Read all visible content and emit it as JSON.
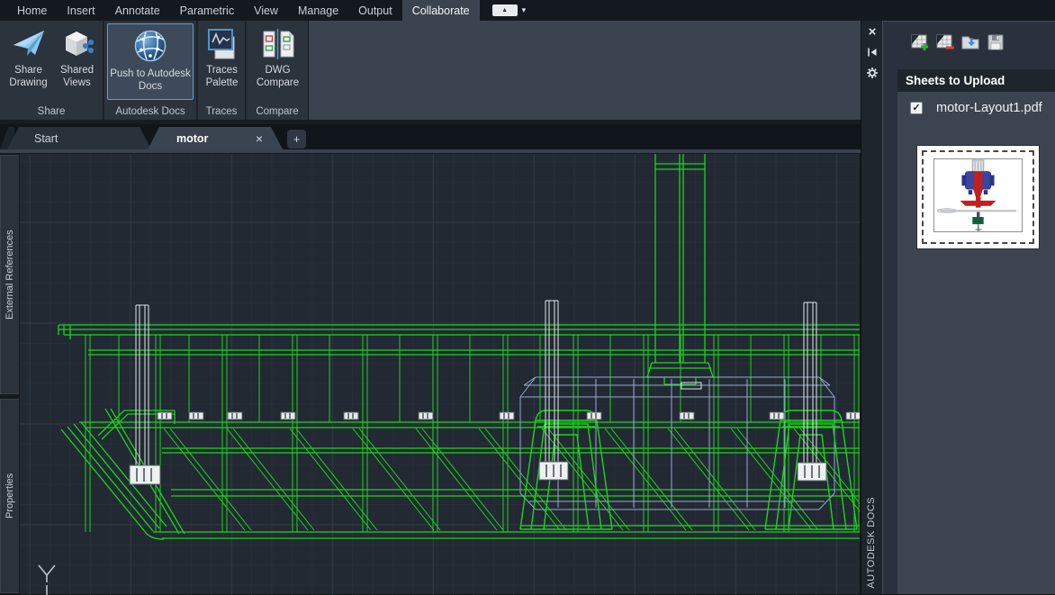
{
  "menubar": {
    "items": [
      "Home",
      "Insert",
      "Annotate",
      "Parametric",
      "View",
      "Manage",
      "Output",
      "Collaborate"
    ],
    "active": "Collaborate"
  },
  "ribbon": {
    "buttons": [
      {
        "id": "share-drawing",
        "label": "Share Drawing"
      },
      {
        "id": "shared-views",
        "label": "Shared Views"
      },
      {
        "id": "push-to-autodesk-docs",
        "label": "Push to Autodesk Docs",
        "highlighted": true
      },
      {
        "id": "traces-palette",
        "label": "Traces Palette"
      },
      {
        "id": "dwg-compare",
        "label": "DWG Compare"
      }
    ],
    "groups": [
      "Share",
      "Autodesk Docs",
      "Traces",
      "Compare"
    ]
  },
  "file_tabs": {
    "tabs": [
      {
        "label": "Start",
        "active": false
      },
      {
        "label": "motor",
        "active": true,
        "closable": true
      }
    ]
  },
  "left_panel_tabs": [
    "External References",
    "Properties"
  ],
  "docs_panel": {
    "title_vertical": "AUTODESK DOCS",
    "toolbar_icons": [
      "add-sheet",
      "remove-sheet",
      "open-folder",
      "save"
    ],
    "header": "Sheets to Upload",
    "sheet": {
      "name": "motor-Layout1.pdf",
      "checked": true
    }
  },
  "icons": {
    "close": "×",
    "plus": "+",
    "check": "✓",
    "caret_up": "▲",
    "caret_down": "▾"
  },
  "colors": {
    "wireframe_green": "#1bd41b",
    "tank_blue": "#98a8d0",
    "highlight_border": "#56a0d8",
    "canvas_bg": "#222933",
    "white_lines": "#e4e8eb"
  }
}
